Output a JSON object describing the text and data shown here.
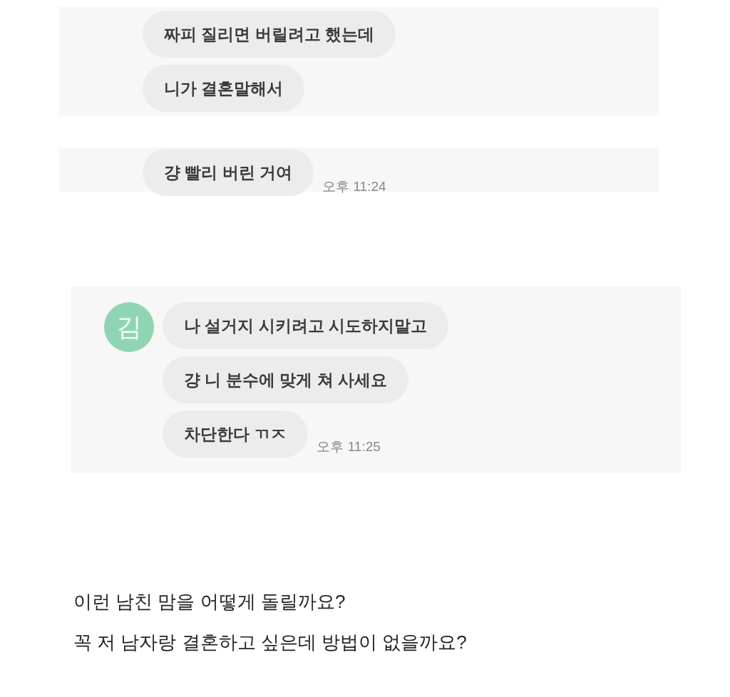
{
  "chat_panels": [
    {
      "messages": [
        "짜피 질리면 버릴려고 했는데",
        "니가 결혼말해서"
      ]
    },
    {
      "messages": [
        "걍 빨리 버린 거여"
      ],
      "time": "오후 11:24"
    },
    {
      "avatar": "김",
      "messages": [
        "나 설거지 시키려고 시도하지말고",
        "걍 니 분수에 맞게 쳐 사세요",
        "차단한다 ㄲㅈ"
      ],
      "time": "오후 11:25"
    }
  ],
  "caption": [
    "이런 남친 맘을 어떻게 돌릴까요?",
    "꼭 저 남자랑 결혼하고 싶은데 방법이 없을까요?"
  ]
}
